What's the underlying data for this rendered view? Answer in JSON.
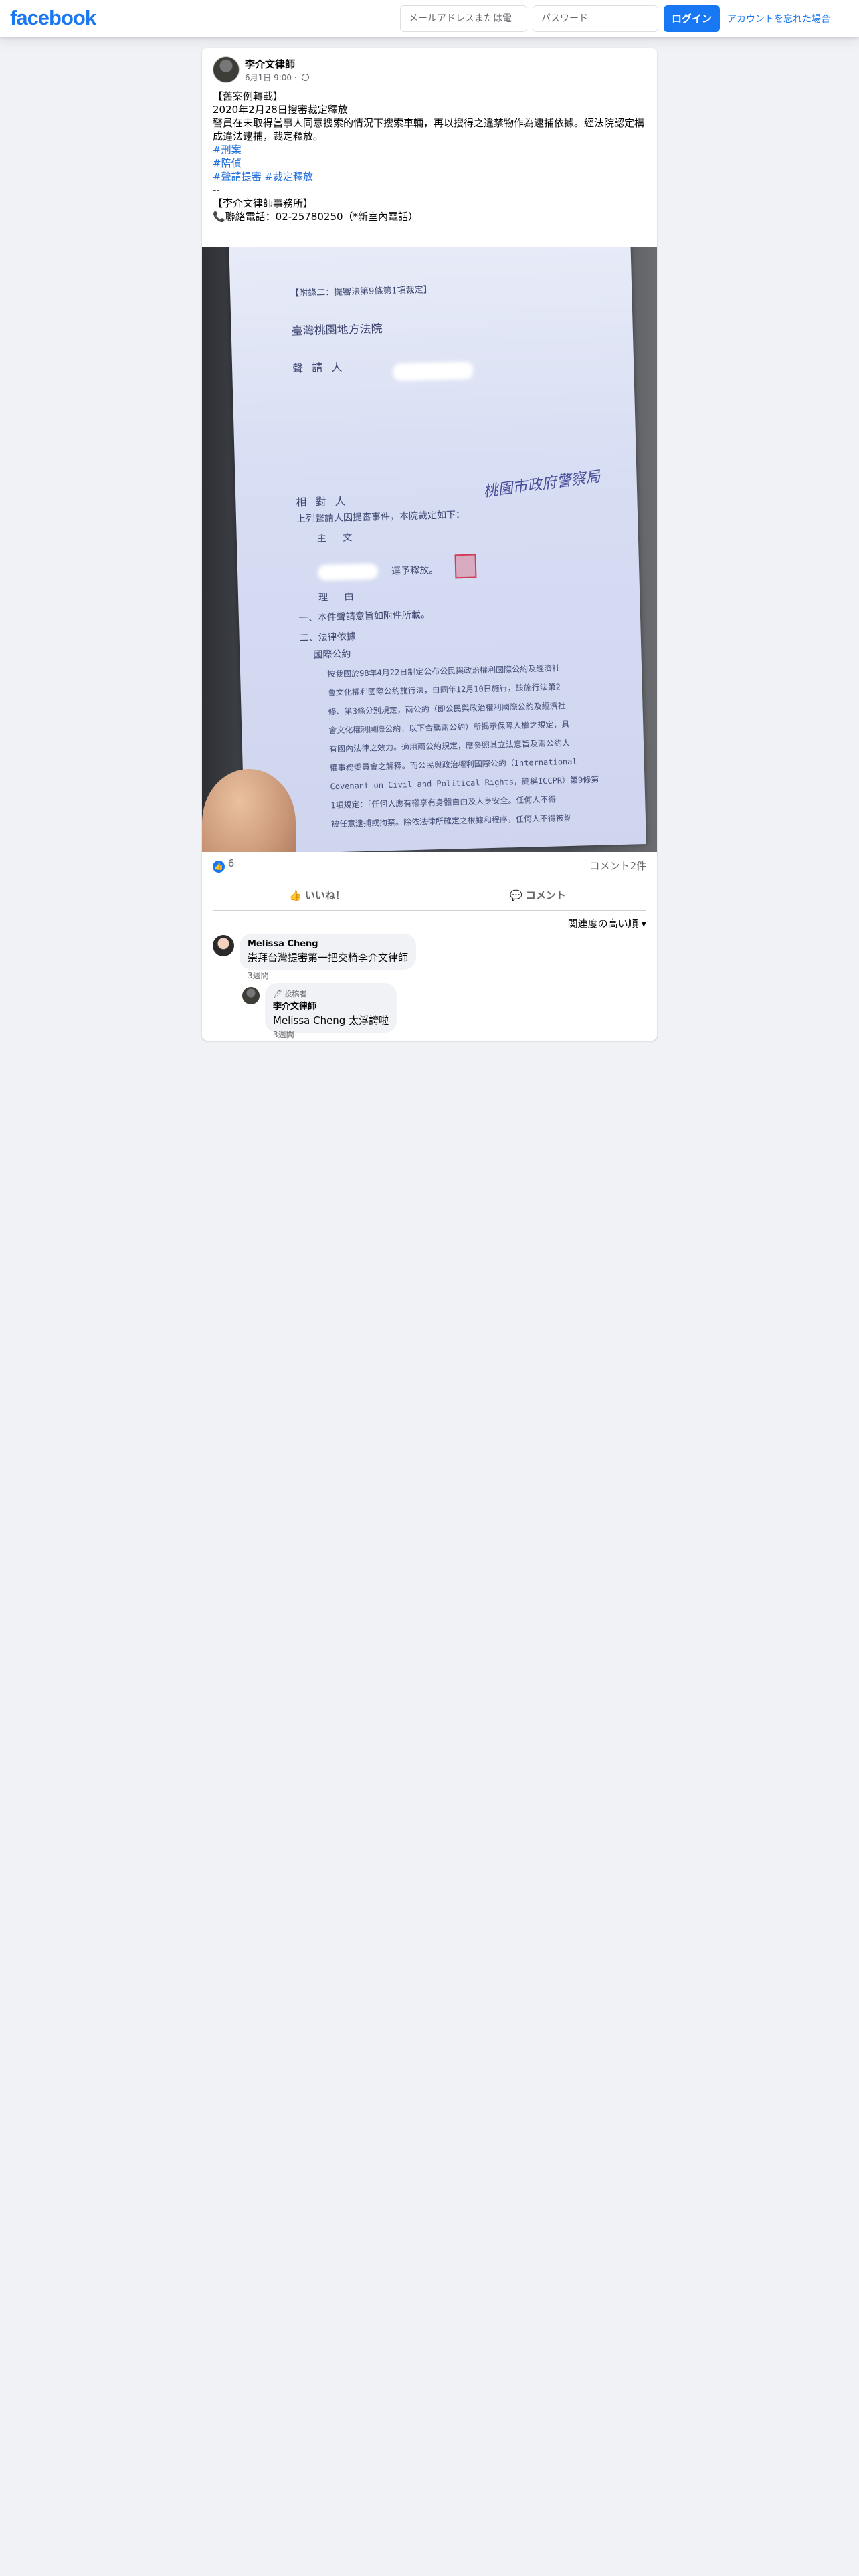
{
  "header": {
    "logo": "facebook",
    "email_placeholder": "メールアドレスまたは電",
    "password_placeholder": "パスワード",
    "login_label": "ログイン",
    "forgot_label": "アカウントを忘れた場合"
  },
  "post": {
    "author": "李介文律師",
    "date": "6月1日 9:00 ·",
    "text_lines": [
      "【舊案例轉載】",
      "2020年2月28日搜審裁定釋放",
      "警員在未取得當事人同意搜索的情況下搜索車輛，再以搜得之違禁物作為逮捕依據。經法院認定構",
      "成違法逮捕，裁定釋放。"
    ],
    "tags": [
      "#刑案",
      "#陪偵",
      "#聲請提審 #裁定釋放"
    ],
    "footer_lines": [
      "--",
      "【李介文律師事務所】",
      "📞聯絡電話：02-25780250（*新室內電話）"
    ]
  },
  "document": {
    "header_tag": "【附錄二：提審法第9條第1項裁定】",
    "court": "臺灣桃園地方法院",
    "applicant_label": "聲 請 人",
    "respondent_label": "相 對 人",
    "body": [
      "上列聲請人因提審事件，本院裁定如下：",
      "主 文",
      "逕予釋放。",
      "理 由",
      "一、本件聲請意旨如附件所載。",
      "二、法律依據",
      "國際公約",
      "按我國於98年4月22日制定公布公民與政治權利國際公約及經濟社",
      "會文化權利國際公約施行法，自同年12月10日施行，該施行法第2",
      "條、第3條分別規定，兩公約（即公民與政治權利國際公約及經濟社",
      "會文化權利國際公約，以下合稱兩公約）所揭示保障人權之規定，具",
      "有國內法律之效力。適用兩公約規定，應參照其立法意旨及兩公約人",
      "權事務委員會之解釋。而公民與政治權利國際公約（International",
      "Covenant on Civil and Political Rights，簡稱ICCPR）第9條第",
      "1項規定：「任何人應有權享有身體自由及人身安全。任何人不得",
      "被任意逮捕或拘禁。除依法律所確定之根據和程序，任何人不得被剝"
    ],
    "handwriting": "桃園市政府警察局"
  },
  "reactions": {
    "like_count": "6",
    "comment_count": "コメント2件",
    "like_action": "いいね！",
    "comment_action": "コメント",
    "sort_label": "関連度の高い順"
  },
  "comments": [
    {
      "name": "Melissa Cheng",
      "text": "崇拜台灣提審第一把交椅李介文律師",
      "time": "3週間"
    },
    {
      "badge": "投稿者",
      "name": "李介文律師",
      "text": "Melissa Cheng 太浮誇啦",
      "time": "3週間"
    }
  ]
}
